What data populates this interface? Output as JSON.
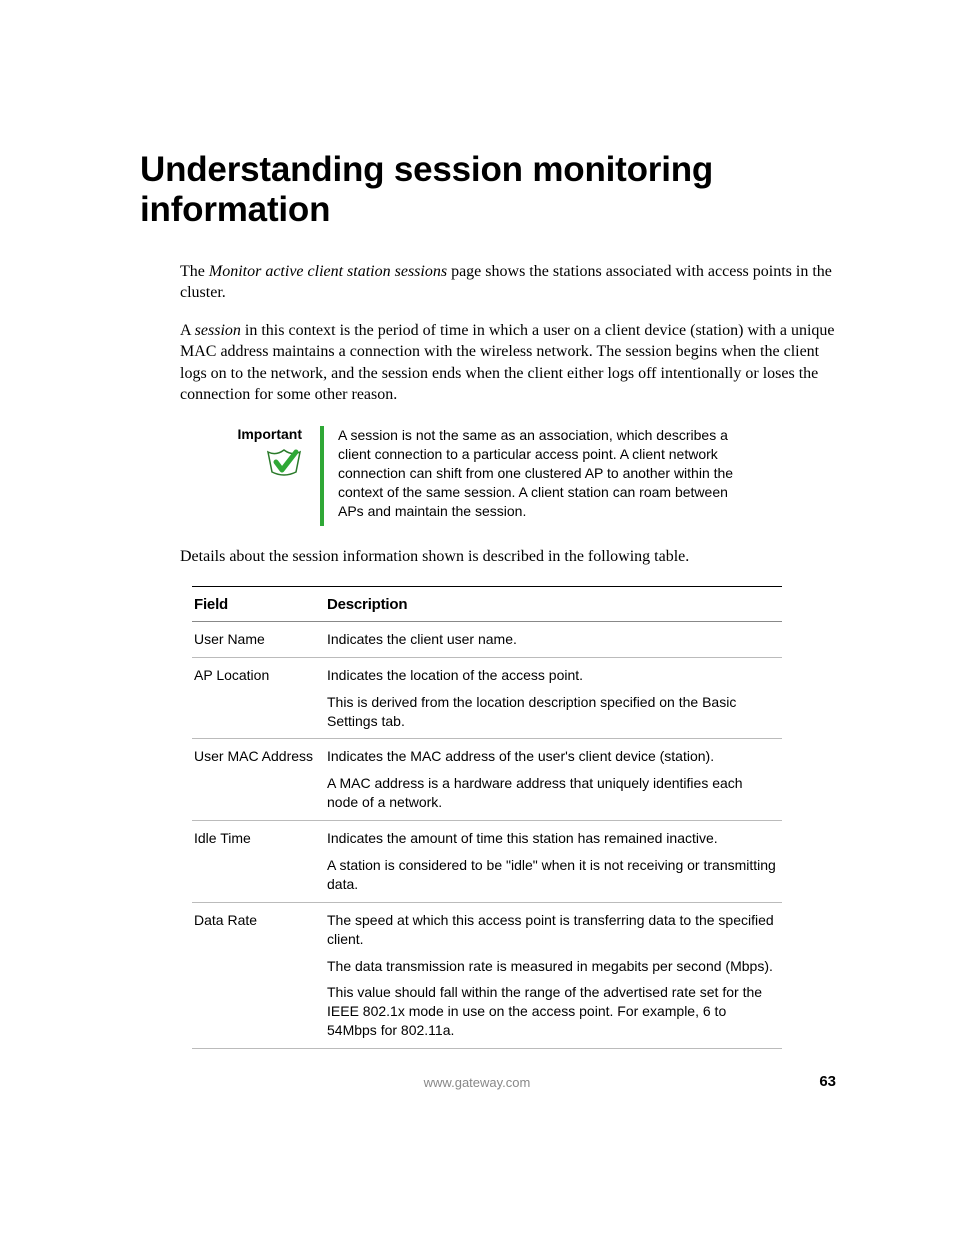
{
  "title": "Understanding session monitoring information",
  "intro": {
    "p1_pre": "The ",
    "p1_em": "Monitor active client station sessions",
    "p1_post": " page shows the stations associated with access points in the cluster.",
    "p2_pre": "A ",
    "p2_em": "session",
    "p2_post": " in this context is the period of time in which a user on a client device (station) with a unique MAC address maintains a connection with the wireless network. The session begins when the client logs on to the network, and the session ends when the client either logs off intentionally or loses the connection for some other reason."
  },
  "callout": {
    "label": "Important",
    "text": "A session is not the same as an association, which describes a client connection to a particular access point. A client network connection can shift from one clustered AP to another within the context of the same session. A client station can roam between APs and maintain the session."
  },
  "post_callout": "Details about the session information shown is described in the following table.",
  "table": {
    "headers": {
      "field": "Field",
      "desc": "Description"
    },
    "rows": [
      {
        "field": "User Name",
        "desc": [
          "Indicates the client user name."
        ]
      },
      {
        "field": "AP Location",
        "desc": [
          "Indicates the location of the access point.",
          "This is derived from the location description specified on the Basic Settings tab."
        ]
      },
      {
        "field": "User MAC Address",
        "desc": [
          "Indicates the MAC address of the user's client device (station).",
          "A MAC address is a hardware address that uniquely identifies each node of a network."
        ]
      },
      {
        "field": "Idle Time",
        "desc": [
          "Indicates the amount of time this station has remained inactive.",
          "A station is considered to be \"idle\" when it is not receiving or transmitting data."
        ]
      },
      {
        "field": "Data Rate",
        "desc": [
          "The speed at which this access point is transferring data to the specified client.",
          "The data transmission rate is measured in megabits per second (Mbps).",
          "This value should fall within the range of the advertised rate set for the IEEE 802.1x mode in use on the access point. For example, 6 to 54Mbps for 802.11a."
        ]
      }
    ]
  },
  "footer": {
    "url": "www.gateway.com",
    "page": "63"
  }
}
